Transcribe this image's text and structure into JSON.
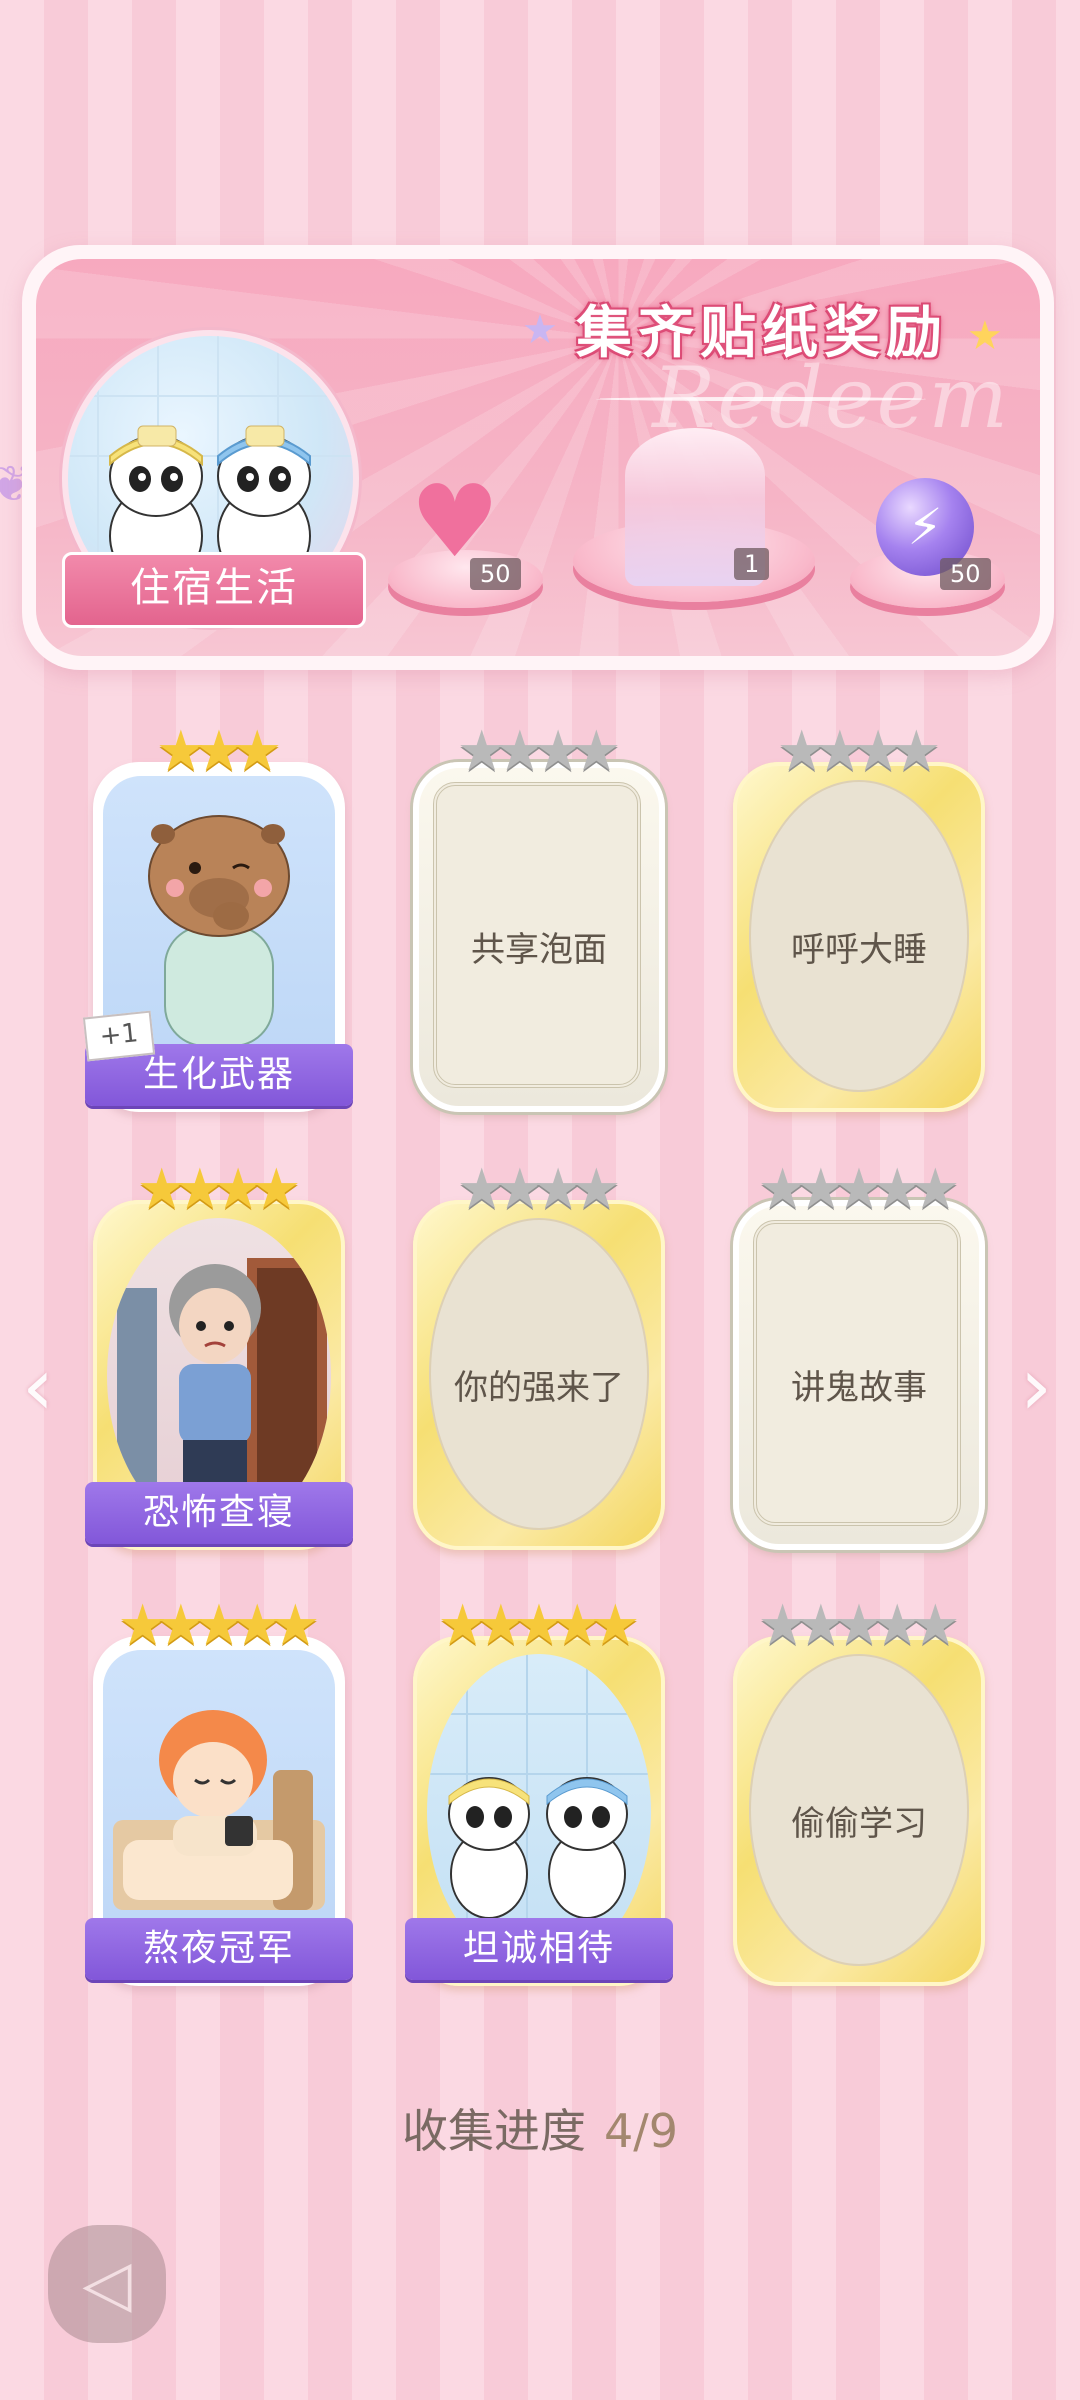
{
  "banner": {
    "title": "集齐贴纸奖励",
    "watermark": "Redeem",
    "theme_name": "住宿生活",
    "rewards": [
      {
        "icon": "heart-gem-icon",
        "count": "50"
      },
      {
        "icon": "dress-icon",
        "count": "1"
      },
      {
        "icon": "energy-orb-icon",
        "count": "50"
      }
    ]
  },
  "cards": [
    {
      "name": "生化武器",
      "collected": true,
      "stars": 3,
      "max_stars": 3,
      "badge": "+1",
      "frame": "white"
    },
    {
      "name": "共享泡面",
      "collected": false,
      "stars": 0,
      "max_stars": 4,
      "frame": "silver"
    },
    {
      "name": "呼呼大睡",
      "collected": false,
      "stars": 0,
      "max_stars": 4,
      "frame": "gold"
    },
    {
      "name": "恐怖查寝",
      "collected": true,
      "stars": 4,
      "max_stars": 4,
      "frame": "gold"
    },
    {
      "name": "你的强来了",
      "collected": false,
      "stars": 0,
      "max_stars": 4,
      "frame": "gold"
    },
    {
      "name": "讲鬼故事",
      "collected": false,
      "stars": 0,
      "max_stars": 5,
      "frame": "silver"
    },
    {
      "name": "熬夜冠军",
      "collected": true,
      "stars": 5,
      "max_stars": 5,
      "frame": "white"
    },
    {
      "name": "坦诚相待",
      "collected": true,
      "stars": 5,
      "max_stars": 5,
      "frame": "gold"
    },
    {
      "name": "偷偷学习",
      "collected": false,
      "stars": 0,
      "max_stars": 5,
      "frame": "gold"
    }
  ],
  "progress": {
    "label": "收集进度",
    "value": "4/9"
  },
  "icons": {
    "prev": "chevron-left-icon",
    "next": "chevron-right-icon",
    "back": "back-icon"
  },
  "colors": {
    "accent_purple": "#8a5fdd",
    "banner_pink": "#f6a9be",
    "star_gold": "#f6c93a",
    "star_grey": "#b9b9b9"
  }
}
